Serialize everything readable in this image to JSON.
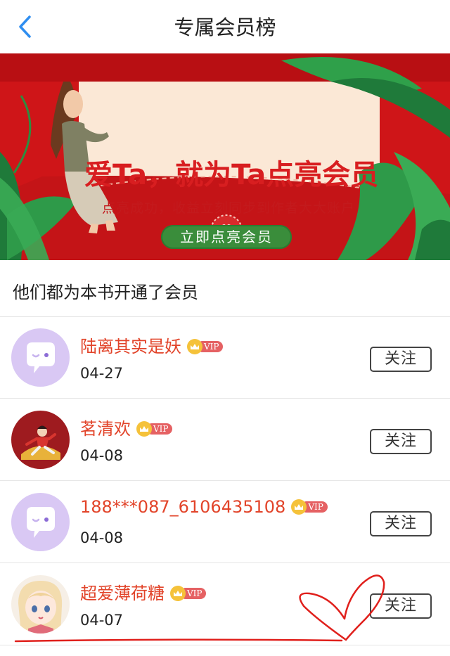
{
  "nav": {
    "title": "专属会员榜",
    "back_icon": "chevron-left-icon",
    "accent": "#2f8ef0"
  },
  "banner": {
    "title": "爱Ta，就为Ta点亮会员",
    "subtitle": "点亮成功，收益立刻同步到作者大大账户",
    "cta_label": "立即点亮会员",
    "colors": {
      "background": "#cf1518",
      "card": "#fbe8d6",
      "cta": "#3a8d3b"
    }
  },
  "section": {
    "heading": "他们都为本书开通了会员"
  },
  "members": [
    {
      "name": "陆离其实是妖",
      "date": "04-27",
      "vip_label": "VIP",
      "follow_label": "关注",
      "avatar": "default-avatar-icon"
    },
    {
      "name": "茗清欢",
      "date": "04-08",
      "vip_label": "VIP",
      "follow_label": "关注",
      "avatar": "illustrated-avatar"
    },
    {
      "name": "188***087_6106435108",
      "date": "04-08",
      "vip_label": "VIP",
      "follow_label": "关注",
      "avatar": "default-avatar-icon"
    },
    {
      "name": "超爱薄荷糖",
      "date": "04-07",
      "vip_label": "VIP",
      "follow_label": "关注",
      "avatar": "anime-girl-avatar"
    }
  ],
  "colors": {
    "member_name": "#e2442a",
    "vip_badge": "#e56163",
    "crown": "#f5c23a",
    "annotation": "#e0201c"
  }
}
